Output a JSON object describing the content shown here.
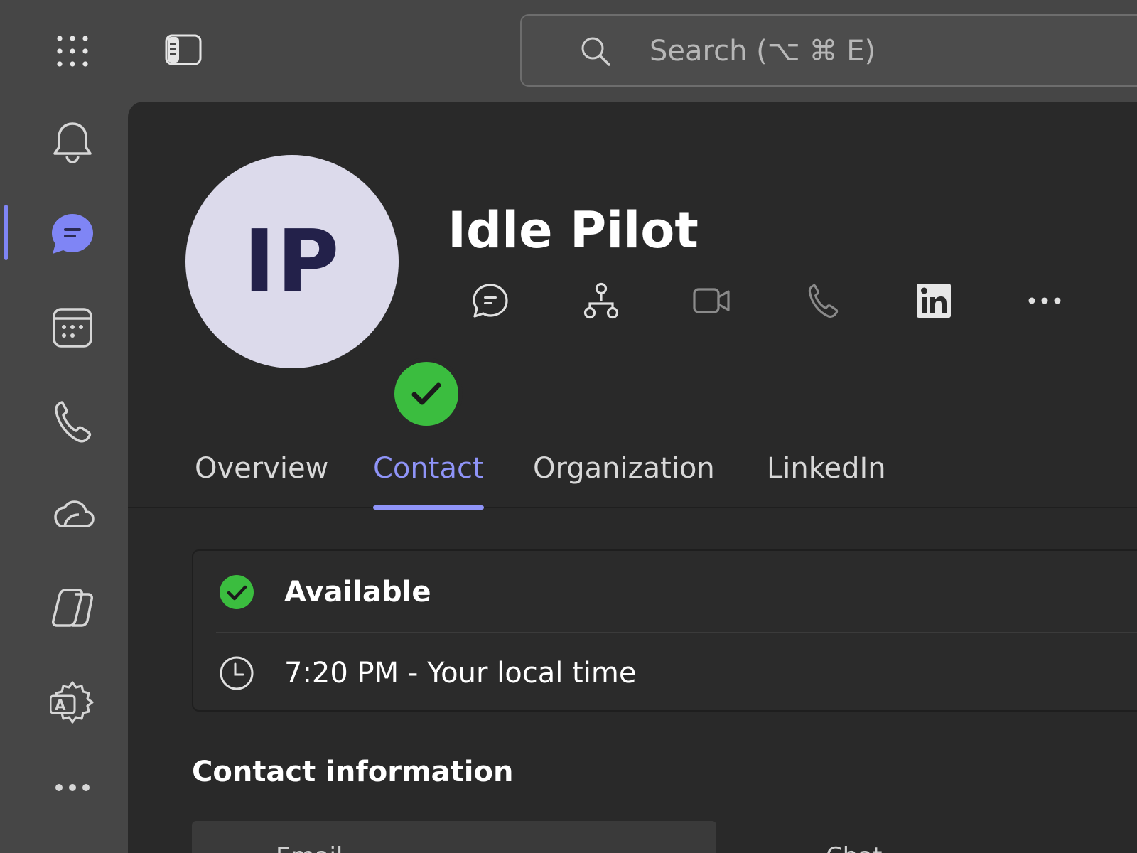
{
  "search": {
    "placeholder": "Search (⌥ ⌘ E)"
  },
  "profile": {
    "initials": "IP",
    "name": "Idle Pilot"
  },
  "tabs": [
    {
      "label": "Overview"
    },
    {
      "label": "Contact"
    },
    {
      "label": "Organization"
    },
    {
      "label": "LinkedIn"
    }
  ],
  "status": {
    "availability": "Available",
    "local_time": "7:20 PM - Your local time"
  },
  "contact_info": {
    "title": "Contact information",
    "email_label": "Email",
    "chat_label": "Chat"
  },
  "colors": {
    "accent": "#8f94f8",
    "presence_available": "#3bbd3f",
    "avatar_bg": "#dcdaeb",
    "avatar_text": "#23214a"
  },
  "icons": {
    "rail": [
      "bell-icon",
      "chat-icon",
      "calendar-icon",
      "phone-icon",
      "cloud-icon",
      "copilot-icon",
      "apps-settings-icon",
      "more-icon"
    ],
    "actions": [
      "chat-icon",
      "org-chart-icon",
      "video-icon",
      "phone-icon",
      "linkedin-icon",
      "more-icon"
    ]
  }
}
